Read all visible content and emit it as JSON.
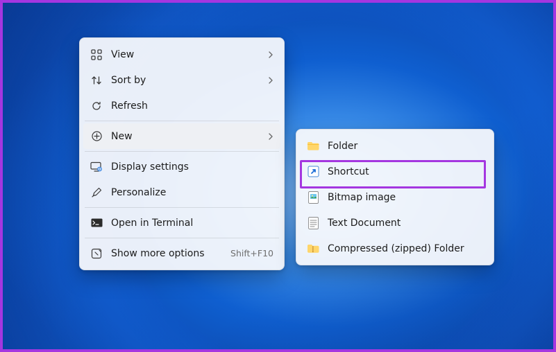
{
  "primary_menu": {
    "items": [
      {
        "label": "View",
        "has_submenu": true
      },
      {
        "label": "Sort by",
        "has_submenu": true
      },
      {
        "label": "Refresh",
        "has_submenu": false
      }
    ],
    "new_item": {
      "label": "New",
      "has_submenu": true
    },
    "items2": [
      {
        "label": "Display settings"
      },
      {
        "label": "Personalize"
      }
    ],
    "terminal": {
      "label": "Open in Terminal"
    },
    "more": {
      "label": "Show more options",
      "shortcut": "Shift+F10"
    }
  },
  "sub_menu": {
    "items": [
      {
        "label": "Folder"
      },
      {
        "label": "Shortcut"
      },
      {
        "label": "Bitmap image"
      },
      {
        "label": "Text Document"
      },
      {
        "label": "Compressed (zipped) Folder"
      }
    ]
  }
}
